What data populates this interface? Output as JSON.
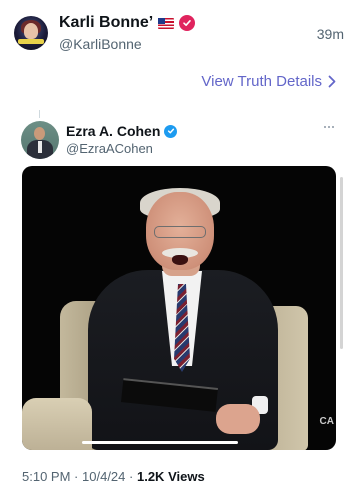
{
  "post": {
    "display_name": "Karli Bonne’",
    "handle": "@KarliBonne",
    "time_ago": "39m",
    "flag_icon": "us-flag-icon",
    "badge_color": "#e0245e"
  },
  "truth_link": {
    "label": "View Truth Details",
    "color": "#6366c9"
  },
  "embedded": {
    "display_name": "Ezra A. Cohen",
    "handle": "@EzraACohen",
    "badge_color": "#1d9bf0",
    "video_watermark": "CA"
  },
  "meta": {
    "time": "5:10 PM",
    "sep1": "·",
    "date": "10/4/24",
    "sep2": "·",
    "views_count": "1.2K",
    "views_label": "Views"
  }
}
